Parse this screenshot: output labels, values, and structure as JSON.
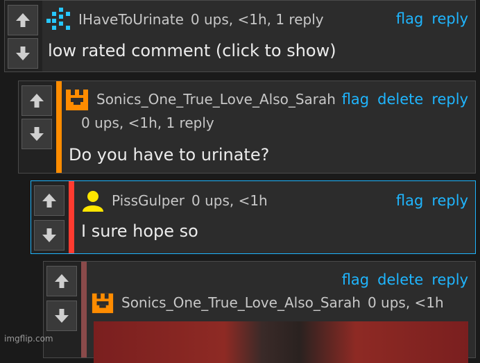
{
  "colors": {
    "accent_link": "#1fb6ff",
    "accent_orange": "#ff8c00",
    "accent_red": "#ff3b30",
    "accent_dim_red": "#8a4a4a",
    "avatar_yellow": "#ffe600",
    "avatar_cyan": "#27c7ff"
  },
  "icons": {
    "upvote": "arrow-up-icon",
    "downvote": "arrow-down-icon"
  },
  "comments": [
    {
      "username": "IHaveToUrinate",
      "meta": "0 ups, <1h, 1 reply",
      "actions": [
        "flag",
        "reply"
      ],
      "body": "low rated comment (click to show)"
    },
    {
      "username": "Sonics_One_True_Love_Also_Sarah",
      "meta": "0 ups, <1h, 1 reply",
      "actions": [
        "flag",
        "delete",
        "reply"
      ],
      "body": "Do you have to urinate?"
    },
    {
      "username": "PissGulper",
      "meta": "0 ups, <1h",
      "actions": [
        "flag",
        "reply"
      ],
      "body": "I sure hope so"
    },
    {
      "username": "Sonics_One_True_Love_Also_Sarah",
      "meta": "0 ups, <1h",
      "actions": [
        "flag",
        "delete",
        "reply"
      ]
    }
  ],
  "watermark": "imgflip.com"
}
